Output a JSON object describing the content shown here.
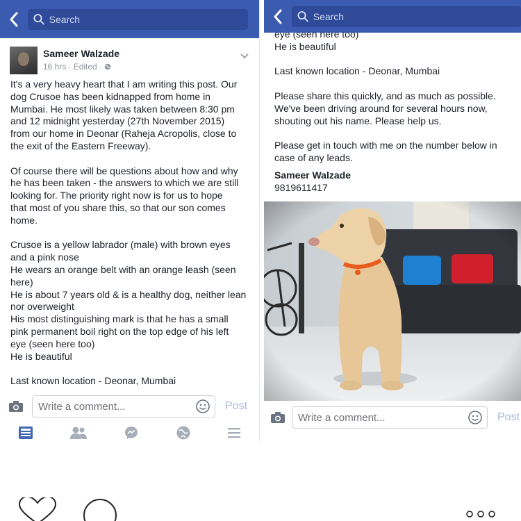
{
  "left": {
    "search_placeholder": "Search",
    "author": "Sameer Walzade",
    "time": "16 hrs",
    "edited": "· Edited ·",
    "post_lines": [
      "It's a very heavy heart that I am writing this post. Our",
      "dog Crusoe has been kidnapped from home in",
      "Mumbai. He most likely was taken between 8:30 pm",
      "and 12 midnight yesterday (27th November 2015)",
      "from our home in Deonar (Raheja Acropolis, close to",
      "the exit of the Eastern Freeway).",
      "",
      "Of course there will be questions about how and why",
      "he has been taken - the answers to which we are still",
      "looking for. The priority right now is for us to hope",
      "that most of you share this, so that our son comes",
      "home.",
      "",
      "Crusoe is a yellow labrador (male) with brown eyes",
      "and a pink nose",
      "He wears an orange belt with an orange leash (seen",
      "here)",
      "He is about 7 years old & is a healthy dog, neither lean",
      "nor overweight",
      "His most distinguishing mark is that he has a small",
      "pink permanent boil right on the top edge of his left",
      "eye (seen here too)",
      "He is beautiful",
      "",
      "Last known location - Deonar, Mumbai"
    ],
    "comment_placeholder": "Write a comment...",
    "post_label": "Post"
  },
  "right": {
    "search_placeholder": "Search",
    "post_lines": [
      "eye (seen here too)",
      "He is beautiful",
      "",
      "Last known location - Deonar, Mumbai",
      "",
      "Please share this quickly, and as much as possible.",
      "We've been driving around for several hours now,",
      "shouting out his name. Please help us.",
      "",
      "Please get in touch with me on the number below in",
      "case of any leads."
    ],
    "signature_name": "Sameer Walzade",
    "phone": "9819611417",
    "comment_placeholder": "Write a comment...",
    "post_label": "Post"
  },
  "tabs": [
    "news-feed",
    "friends",
    "messenger",
    "notifications",
    "more"
  ],
  "colors": {
    "topbar": "#3b5bb0",
    "active_tab": "#4267b2",
    "inactive_tab": "#a8aeb9"
  }
}
